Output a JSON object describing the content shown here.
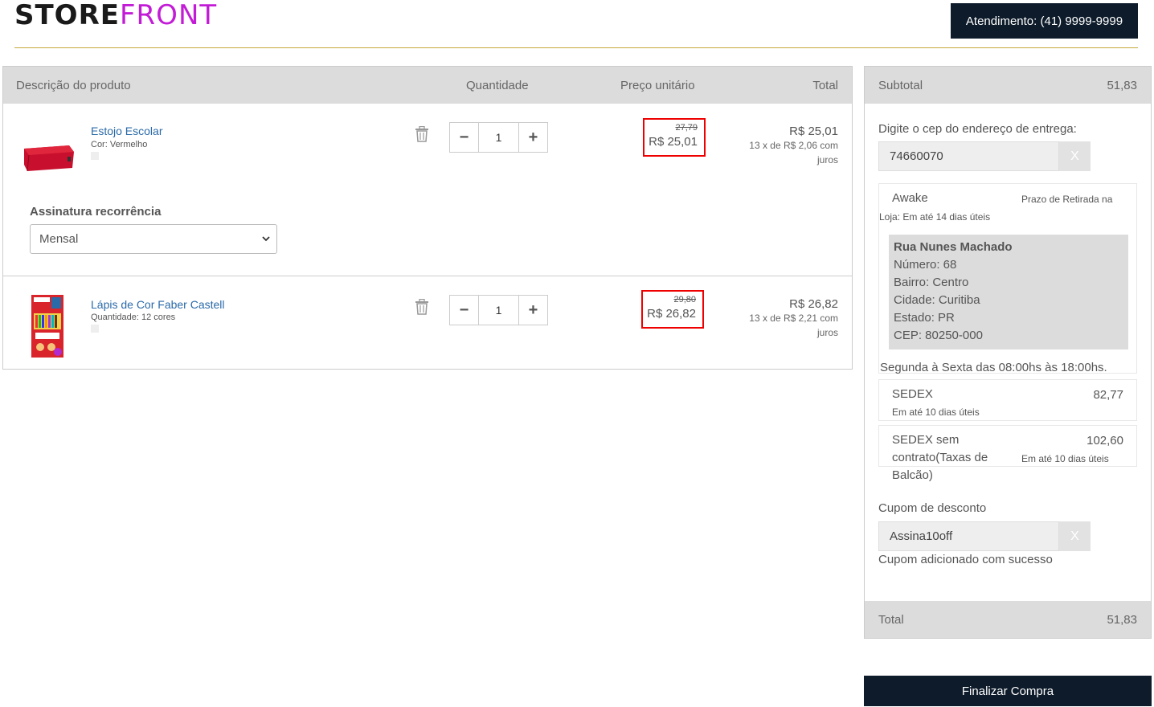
{
  "header": {
    "logo_part1": "STORE",
    "logo_part2": "FRONT",
    "support": "Atendimento: (41) 9999-9999"
  },
  "cart": {
    "columns": {
      "product": "Descrição do produto",
      "quantity": "Quantidade",
      "unit_price": "Preço unitário",
      "total": "Total"
    },
    "items": [
      {
        "name": "Estojo Escolar",
        "attribute": "Cor: Vermelho",
        "quantity": "1",
        "old_price": "27,79",
        "price": "R$ 25,01",
        "total": "R$ 25,01",
        "installments": "13 x de R$ 2,06 com juros"
      },
      {
        "name": "Lápis de Cor Faber Castell",
        "attribute": "Quantidade: 12 cores",
        "quantity": "1",
        "old_price": "29,80",
        "price": "R$ 26,82",
        "total": "R$ 26,82",
        "installments": "13 x de R$ 2,21 com juros"
      }
    ],
    "subscription": {
      "label": "Assinatura recorrência",
      "selected": "Mensal"
    }
  },
  "summary": {
    "subtotal_label": "Subtotal",
    "subtotal_value": "51,83",
    "cep_label": "Digite o cep do endereço de entrega:",
    "cep_value": "74660070",
    "clear_label": "X",
    "pickup": {
      "name": "Awake",
      "deadline_prefix": "Prazo de Retirada na",
      "deadline_suffix": "Loja: Em até 14 dias úteis",
      "street": "Rua Nunes Machado",
      "number": "Número: 68",
      "district": "Bairro: Centro",
      "city": "Cidade: Curitiba",
      "state": "Estado: PR",
      "zip": "CEP: 80250-000",
      "hours": "Segunda à Sexta das 08:00hs às 18:00hs."
    },
    "shipping": [
      {
        "name": "SEDEX",
        "price": "82,77",
        "deadline": "Em até 10 dias úteis"
      },
      {
        "name_line1": "SEDEX sem",
        "name_line2": "contrato(Taxas de",
        "name_line3": "Balcão)",
        "price": "102,60",
        "deadline": "Em até 10 dias úteis"
      }
    ],
    "coupon_label": "Cupom de desconto",
    "coupon_value": "Assina10off",
    "coupon_message": "Cupom adicionado com sucesso",
    "total_label": "Total",
    "total_value": "51,83"
  },
  "checkout_label": "Finalizar Compra"
}
